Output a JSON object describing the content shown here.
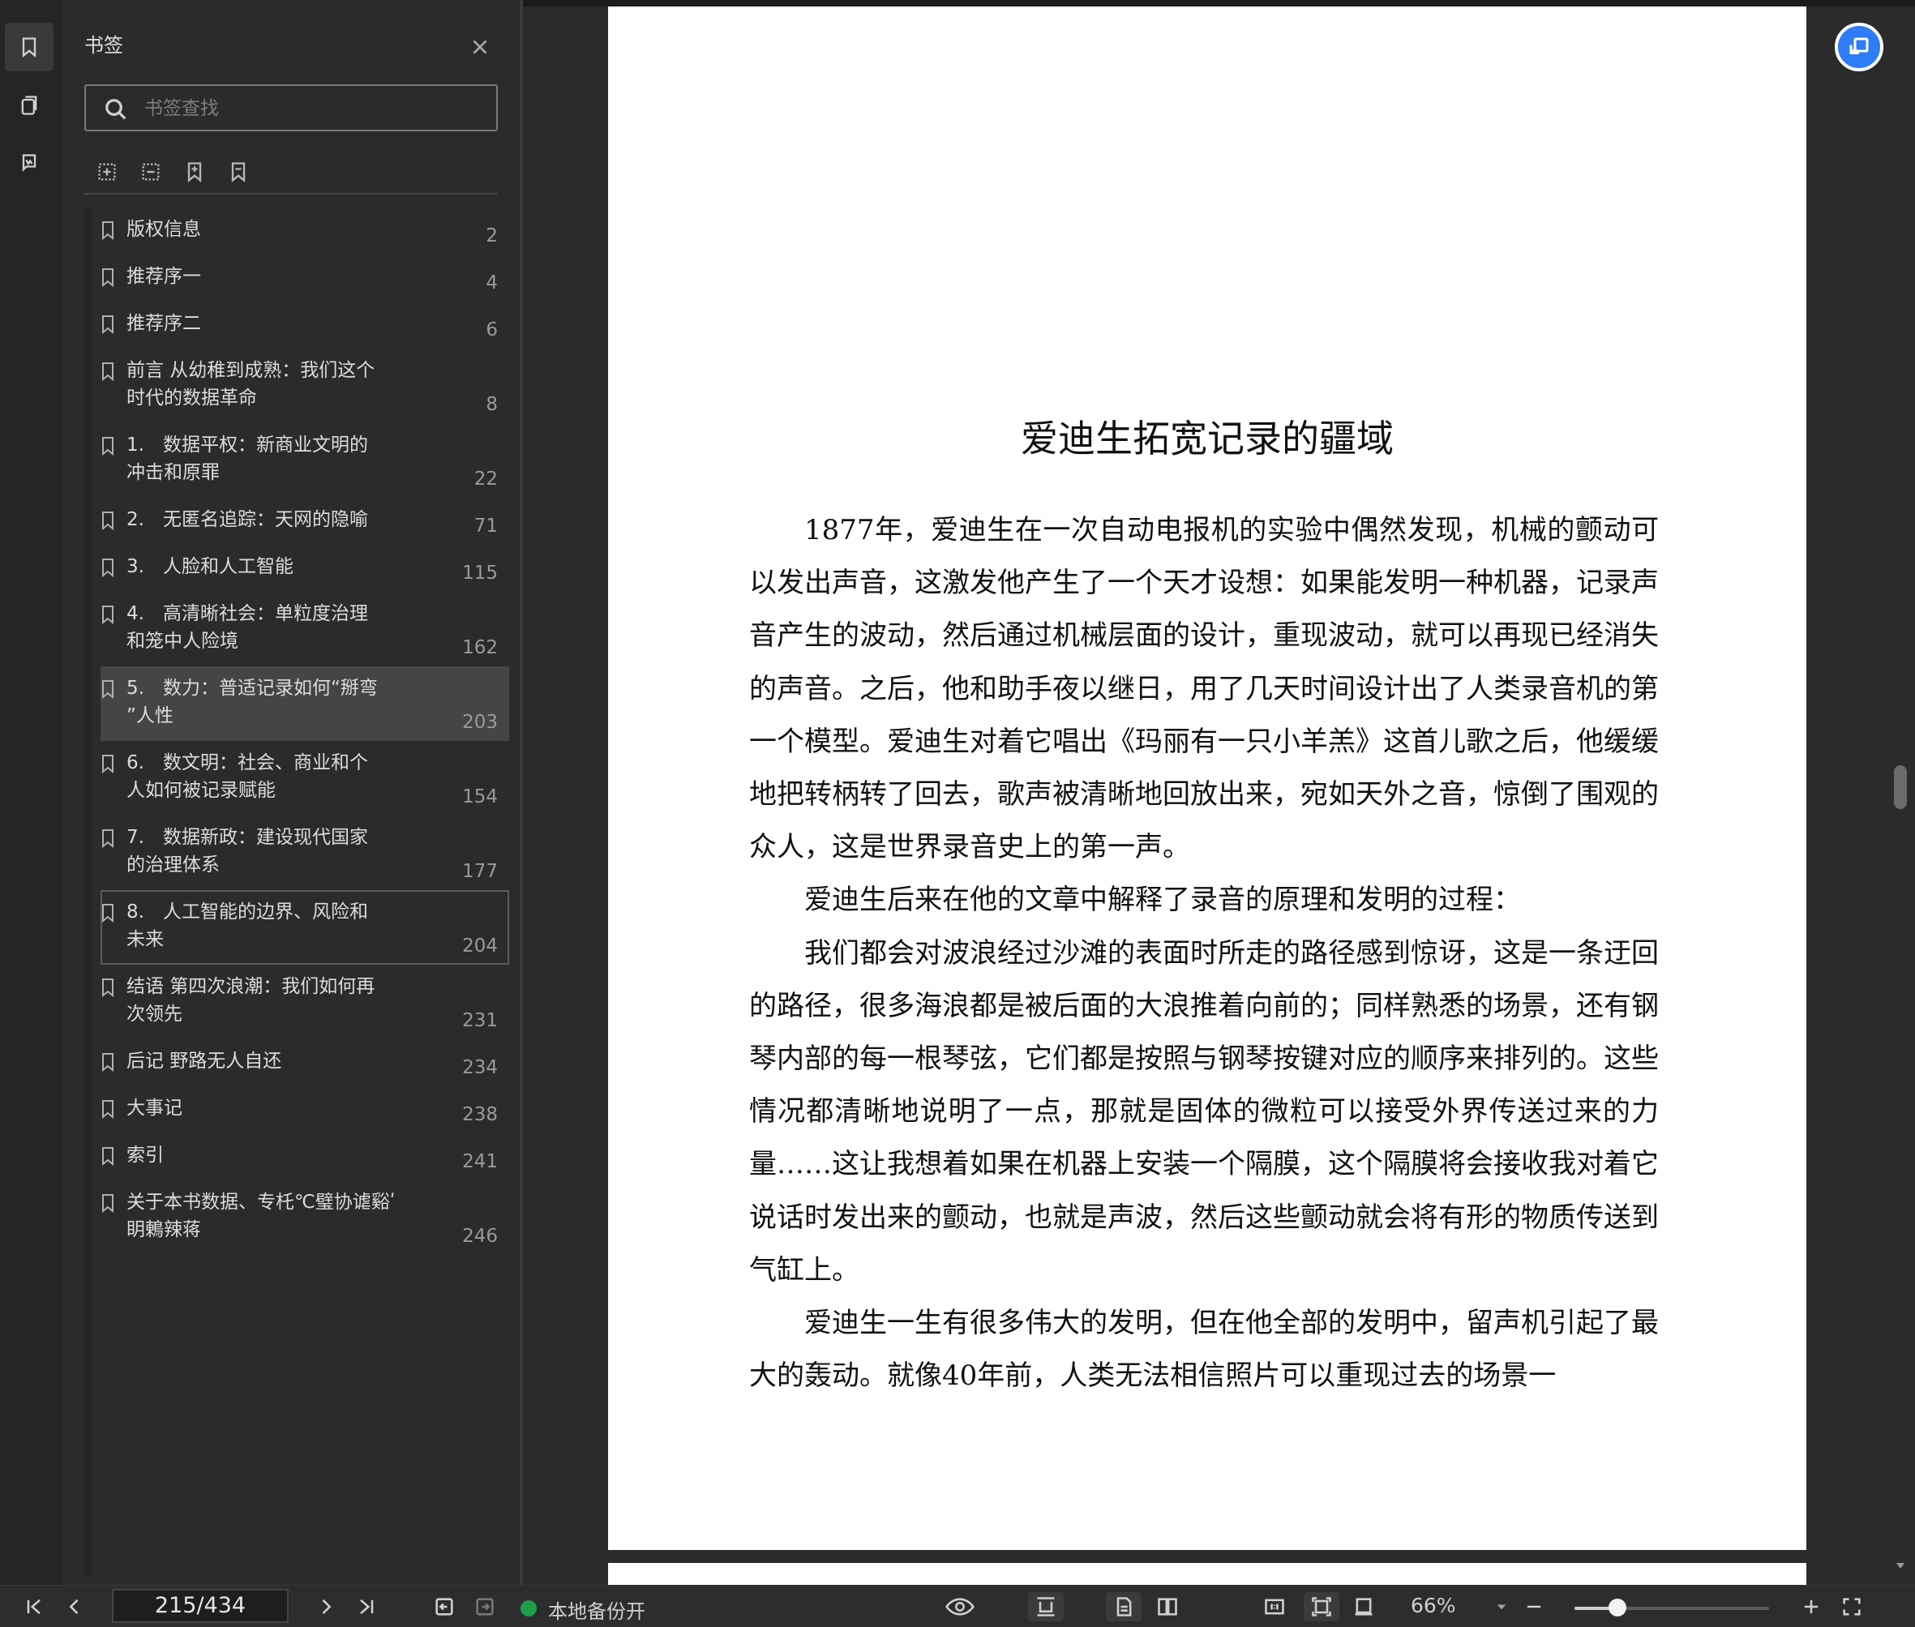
{
  "sidebar_panel": {
    "title": "书签",
    "search_placeholder": "书签查找",
    "items": [
      {
        "label": "版权信息",
        "page": "2"
      },
      {
        "label": "推荐序一",
        "page": "4"
      },
      {
        "label": "推荐序二",
        "page": "6"
      },
      {
        "label": "前言 从幼稚到成熟：我们这个\n时代的数据革命",
        "page": "8"
      },
      {
        "label": "1.　数据平权：新商业文明的\n冲击和原罪",
        "page": "22"
      },
      {
        "label": "2.　无匿名追踪：天网的隐喻",
        "page": "71"
      },
      {
        "label": "3.　人脸和人工智能",
        "page": "115"
      },
      {
        "label": "4.　高清晰社会：单粒度治理\n和笼中人险境",
        "page": "162"
      },
      {
        "label": "5.　数力：普适记录如何“掰弯\n”人性",
        "page": "203",
        "state": "selected"
      },
      {
        "label": "6.　数文明：社会、商业和个\n人如何被记录赋能",
        "page": "154"
      },
      {
        "label": "7.　数据新政：建设现代国家\n的治理体系",
        "page": "177"
      },
      {
        "label": "8.　人工智能的边界、风险和\n未来",
        "page": "204",
        "state": "outlined"
      },
      {
        "label": "结语 第四次浪潮：我们如何再\n次领先",
        "page": "231"
      },
      {
        "label": "后记 野路无人自还",
        "page": "234"
      },
      {
        "label": "大事记",
        "page": "238"
      },
      {
        "label": "索引",
        "page": "241"
      },
      {
        "label": "关于本书数据、专杔℃璧协谑谿ʹ\n眀鶇辣蒋",
        "page": "246"
      }
    ]
  },
  "document": {
    "title": "爱迪生拓宽记录的疆域",
    "paragraphs": [
      "1877年，爱迪生在一次自动电报机的实验中偶然发现，机械的颤动可以发出声音，这激发他产生了一个天才设想：如果能发明一种机器，记录声音产生的波动，然后通过机械层面的设计，重现波动，就可以再现已经消失的声音。之后，他和助手夜以继日，用了几天时间设计出了人类录音机的第一个模型。爱迪生对着它唱出《玛丽有一只小羊羔》这首儿歌之后，他缓缓地把转柄转了回去，歌声被清晰地回放出来，宛如天外之音，惊倒了围观的众人，这是世界录音史上的第一声。",
      "爱迪生后来在他的文章中解释了录音的原理和发明的过程：",
      "我们都会对波浪经过沙滩的表面时所走的路径感到惊讶，这是一条迂回的路径，很多海浪都是被后面的大浪推着向前的；同样熟悉的场景，还有钢琴内部的每一根琴弦，它们都是按照与钢琴按键对应的顺序来排列的。这些情况都清晰地说明了一点，那就是固体的微粒可以接受外界传送过来的力量……这让我想着如果在机器上安装一个隔膜，这个隔膜将会接收我对着它说话时发出来的颤动，也就是声波，然后这些颤动就会将有形的物质传送到气缸上。",
      "爱迪生一生有很多伟大的发明，但在他全部的发明中，留声机引起了最大的轰动。就像40年前，人类无法相信照片可以重现过去的场景一"
    ]
  },
  "statusbar": {
    "page_indicator": "215/434",
    "backup_label": "本地备份开",
    "zoom_label": "66%",
    "zoom_fraction": 0.22
  },
  "colors": {
    "accent": "#2e7cf6",
    "backup_status": "#1e9e4a",
    "panel_bg": "#2b2b2d",
    "page_bg": "#ffffff"
  },
  "icons": {
    "rail": [
      "bookmark-icon",
      "thumbnails-icon",
      "annotations-icon"
    ],
    "panel_toolbar": [
      "expand-all-icon",
      "collapse-all-icon",
      "add-bookmark-icon",
      "remove-bookmark-icon"
    ],
    "statusbar": [
      "first-page-icon",
      "prev-page-icon",
      "next-page-icon",
      "last-page-icon",
      "back-icon",
      "forward-icon",
      "eye-mode-icon",
      "continuous-scroll-icon",
      "single-page-icon",
      "two-page-icon",
      "actual-size-icon",
      "fit-page-icon",
      "fit-width-icon",
      "zoom-out-icon",
      "zoom-in-icon",
      "fullscreen-icon"
    ]
  }
}
